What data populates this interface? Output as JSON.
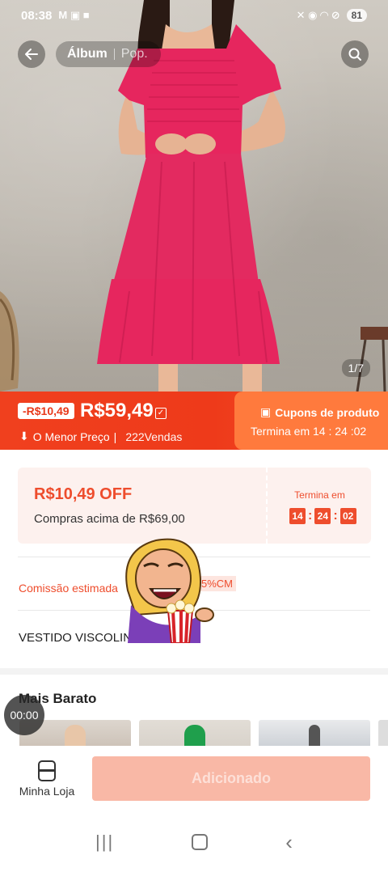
{
  "status_bar": {
    "time": "08:38",
    "left_icons": "M ▣ ■",
    "right_icons": "✕ ◉ ◠ ⊘",
    "battery": "81"
  },
  "header": {
    "tab_album": "Álbum",
    "tab_pop": "Pop.",
    "back_icon": "back-arrow-icon",
    "search_icon": "search-icon"
  },
  "gallery": {
    "pager": "1/7"
  },
  "price_banner": {
    "discount": "-R$10,49",
    "price": "R$59,49",
    "lowest_label": "O Menor Preço",
    "sales": "222Vendas",
    "coupon_title": "Cupons de produto",
    "coupon_ends": "Termina em 14 : 24 :02"
  },
  "coupon": {
    "off": "R$10,49 OFF",
    "condition": "Compras acima de R$69,00",
    "ends_label": "Termina em",
    "hh": "14",
    "mm": "24",
    "ss": "02"
  },
  "commission": {
    "label": "Comissão estimada",
    "badge": "5%CM"
  },
  "product": {
    "title": "VESTIDO VISCOLINHO N..."
  },
  "more_cheaper": {
    "title": "Mais Barato"
  },
  "floating_timer": "00:00",
  "bottom_bar": {
    "shop_label": "Minha Loja",
    "add_button": "Adicionado"
  },
  "colors": {
    "accent": "#ee4d2d",
    "dress": "#e6265e"
  }
}
